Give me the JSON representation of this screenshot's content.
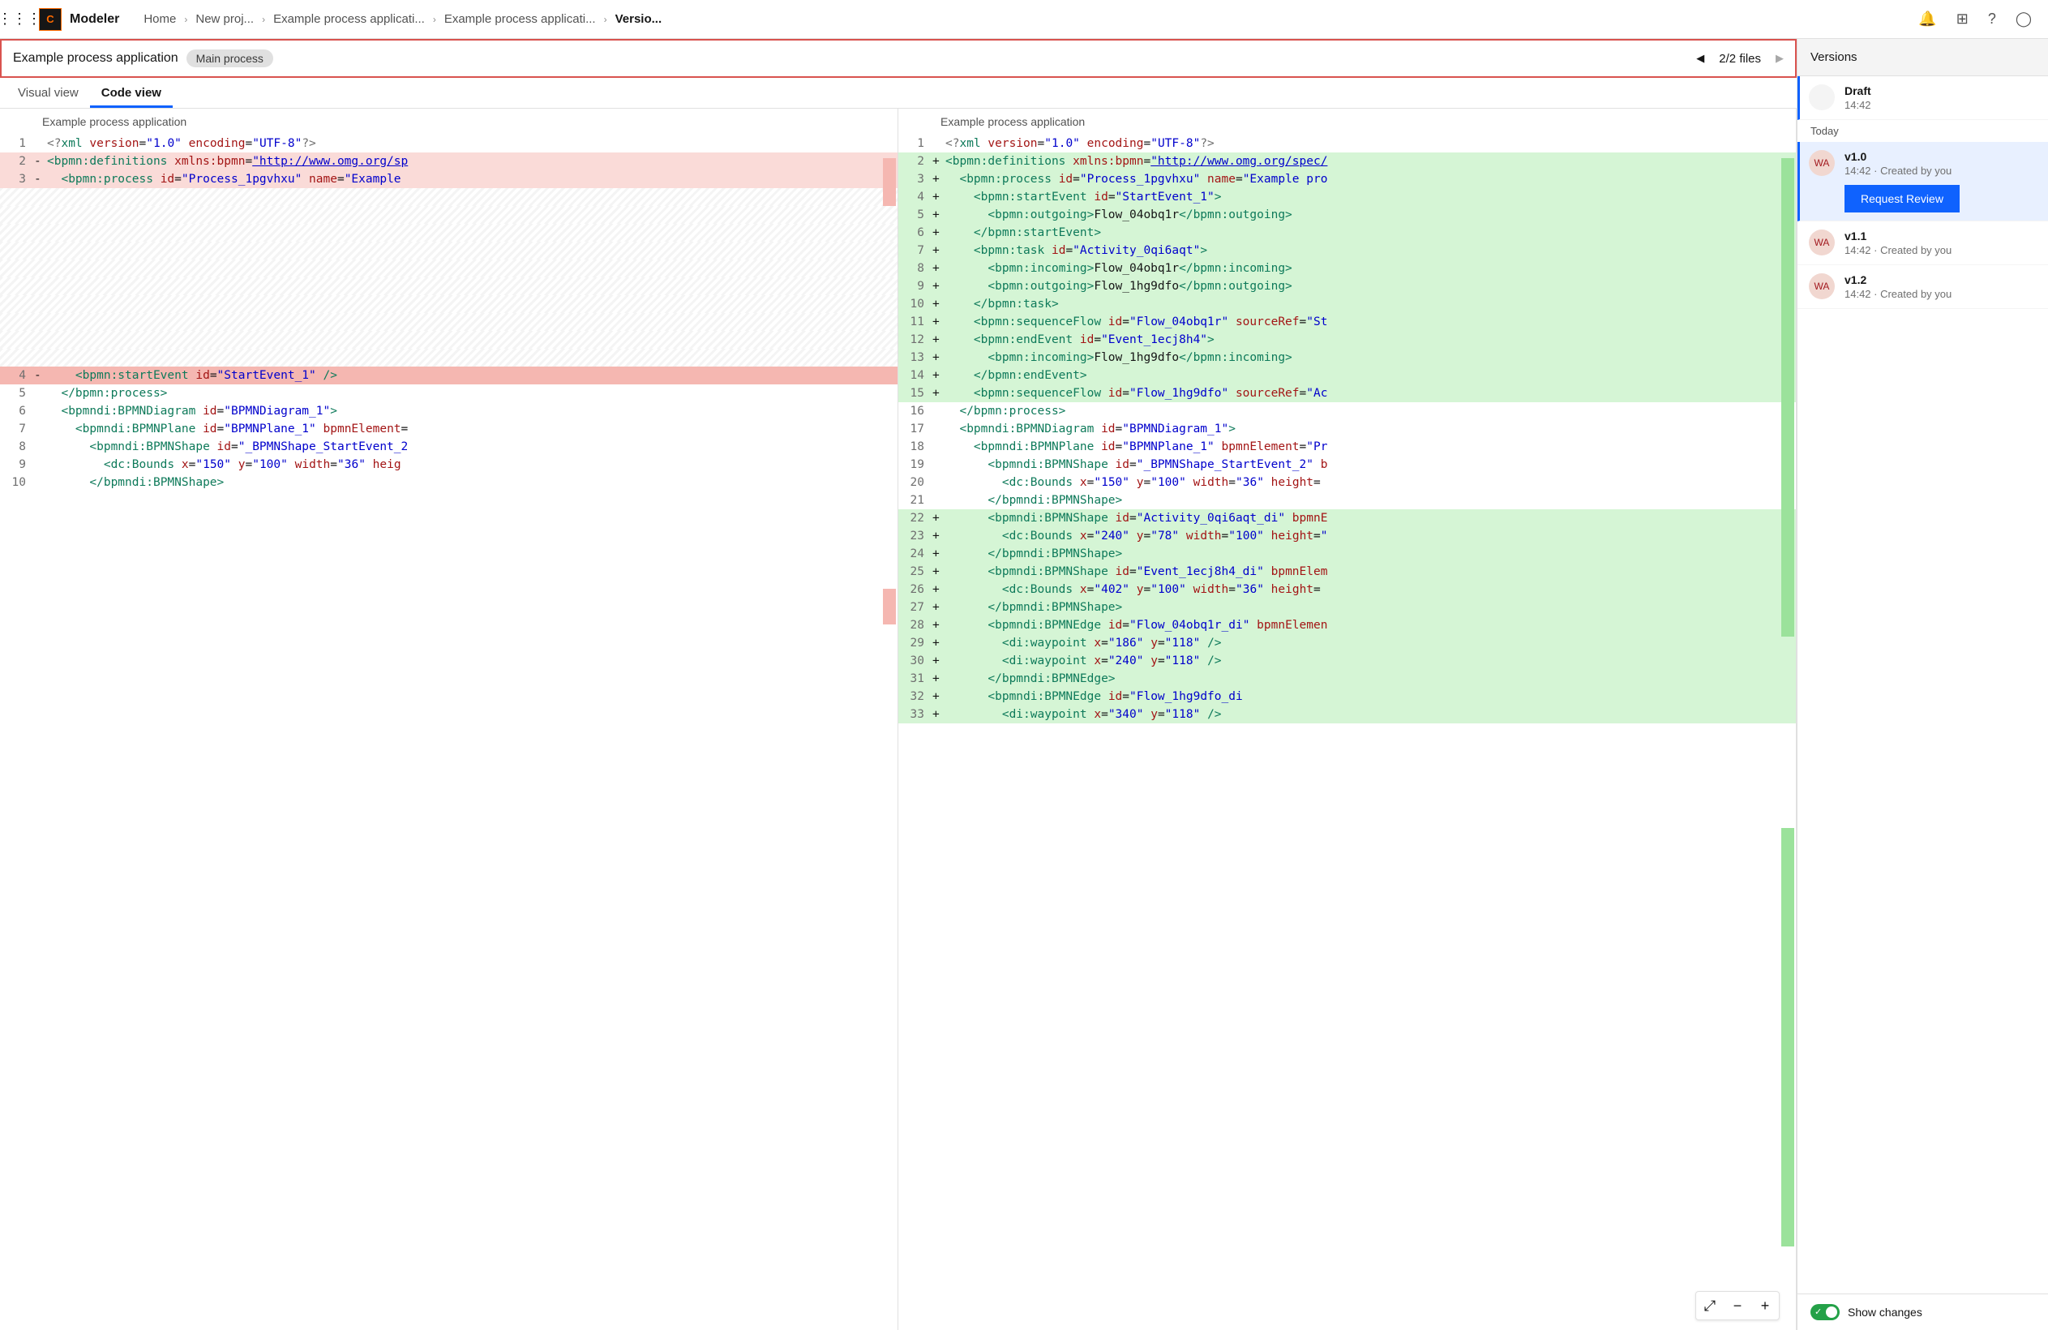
{
  "brand": {
    "initial": "C",
    "name": "Modeler"
  },
  "breadcrumb": {
    "items": [
      "Home",
      "New proj...",
      "Example process applicati...",
      "Example process applicati...",
      "Versio..."
    ]
  },
  "subheader": {
    "title": "Example process application",
    "chip": "Main process",
    "file_counter": "2/2 files"
  },
  "tabs": {
    "visual": "Visual view",
    "code": "Code view"
  },
  "panes": {
    "left_title": "Example process application",
    "right_title": "Example process application"
  },
  "sidebar": {
    "title": "Versions",
    "today": "Today",
    "draft": {
      "name": "Draft",
      "time": "14:42"
    },
    "items": [
      {
        "avatar": "WA",
        "name": "v1.0",
        "sub": "14:42 · Created by you",
        "selected": true,
        "button": "Request Review"
      },
      {
        "avatar": "WA",
        "name": "v1.1",
        "sub": "14:42 · Created by you"
      },
      {
        "avatar": "WA",
        "name": "v1.2",
        "sub": "14:42 · Created by you"
      }
    ],
    "toggle_label": "Show changes"
  },
  "code_left": [
    {
      "n": "1",
      "bg": "",
      "html": "<span class='t-pi'>&lt;?</span><span class='t-tag'>xml</span> <span class='t-dkred'>version</span>=<span class='t-blue'>\"1.0\"</span> <span class='t-dkred'>encoding</span>=<span class='t-blue'>\"UTF-8\"</span><span class='t-pi'>?&gt;</span>"
    },
    {
      "n": "2",
      "bg": "bg-del",
      "gut": "-",
      "html": "<span class='t-green'>&lt;bpmn:definitions</span> <span class='t-dkred'>xmlns:bpmn</span>=<span class='t-blue'><u>\"http://www.omg.org/sp</u></span>"
    },
    {
      "n": "3",
      "bg": "bg-del",
      "gut": "-",
      "html": "  <span class='t-green'>&lt;bpmn:process</span> <span class='t-dkred'>id</span>=<span class='t-blue'>\"Process_1pgvhxu\"</span> <span class='t-dkred'>name</span>=<span class='t-blue'>\"Example </span>"
    },
    {
      "n": "",
      "bg": "bg-hatch",
      "html": "&nbsp;"
    },
    {
      "n": "",
      "bg": "bg-hatch",
      "html": "&nbsp;"
    },
    {
      "n": "",
      "bg": "bg-hatch",
      "html": "&nbsp;"
    },
    {
      "n": "",
      "bg": "bg-hatch",
      "html": "&nbsp;"
    },
    {
      "n": "",
      "bg": "bg-hatch",
      "html": "&nbsp;"
    },
    {
      "n": "",
      "bg": "bg-hatch",
      "html": "&nbsp;"
    },
    {
      "n": "",
      "bg": "bg-hatch",
      "html": "&nbsp;"
    },
    {
      "n": "",
      "bg": "bg-hatch",
      "html": "&nbsp;"
    },
    {
      "n": "",
      "bg": "bg-hatch",
      "html": "&nbsp;"
    },
    {
      "n": "",
      "bg": "bg-hatch",
      "html": "&nbsp;"
    },
    {
      "n": "4",
      "bg": "bg-del-strong",
      "gut": "-",
      "html": "    <span class='t-green' style='background:#f5b7b1'>&lt;bpmn:startEvent</span> <span class='t-dkred'>id</span>=<span class='t-blue'>\"StartEvent_1\"</span> <span class='t-green'>/&gt;</span>"
    },
    {
      "n": "5",
      "bg": "",
      "html": "  <span class='t-green'>&lt;/bpmn:process&gt;</span>"
    },
    {
      "n": "6",
      "bg": "",
      "html": "  <span class='t-green'>&lt;bpmndi:BPMNDiagram</span> <span class='t-dkred'>id</span>=<span class='t-blue'>\"BPMNDiagram_1\"</span><span class='t-green'>&gt;</span>"
    },
    {
      "n": "7",
      "bg": "",
      "html": "    <span class='t-green'>&lt;bpmndi:BPMNPlane</span> <span class='t-dkred'>id</span>=<span class='t-blue'>\"BPMNPlane_1\"</span> <span class='t-dkred'>bpmnElement</span>="
    },
    {
      "n": "8",
      "bg": "",
      "html": "      <span class='t-green'>&lt;bpmndi:BPMNShape</span> <span class='t-dkred'>id</span>=<span class='t-blue'>\"_BPMNShape_StartEvent_2</span>"
    },
    {
      "n": "9",
      "bg": "",
      "html": "        <span class='t-green'>&lt;dc:Bounds</span> <span class='t-dkred'>x</span>=<span class='t-blue'>\"150\"</span> <span class='t-dkred'>y</span>=<span class='t-blue'>\"100\"</span> <span class='t-dkred'>width</span>=<span class='t-blue'>\"36\"</span> <span class='t-dkred'>heig</span>"
    },
    {
      "n": "10",
      "bg": "",
      "html": "      <span class='t-green'>&lt;/bpmndi:BPMNShape&gt;</span>"
    }
  ],
  "code_right": [
    {
      "n": "1",
      "bg": "",
      "html": "<span class='t-pi'>&lt;?</span><span class='t-tag'>xml</span> <span class='t-dkred'>version</span>=<span class='t-blue'>\"1.0\"</span> <span class='t-dkred'>encoding</span>=<span class='t-blue'>\"UTF-8\"</span><span class='t-pi'>?&gt;</span>"
    },
    {
      "n": "2",
      "bg": "bg-add",
      "gut": "+",
      "html": "<span class='t-green'>&lt;bpmn:definitions</span> <span class='t-dkred'>xmlns:bpmn</span>=<span class='t-blue'><u>\"http://www.omg.org/spec/</u></span>"
    },
    {
      "n": "3",
      "bg": "bg-add",
      "gut": "+",
      "html": "  <span class='t-green'>&lt;bpmn:process</span> <span class='t-dkred'>id</span>=<span class='t-blue'>\"Process_1pgvhxu\"</span> <span class='t-dkred'>name</span>=<span class='t-blue'>\"Example pro</span>"
    },
    {
      "n": "4",
      "bg": "bg-add",
      "gut": "+",
      "html": "    <span class='t-green'>&lt;bpmn:startEvent</span> <span class='t-dkred'>id</span>=<span class='t-blue'>\"StartEvent_1\"</span><span class='t-green'>&gt;</span>"
    },
    {
      "n": "5",
      "bg": "bg-add",
      "gut": "+",
      "html": "      <span class='t-green'>&lt;bpmn:outgoing&gt;</span>Flow_04obq1r<span class='t-green'>&lt;/bpmn:outgoing&gt;</span>"
    },
    {
      "n": "6",
      "bg": "bg-add",
      "gut": "+",
      "html": "    <span class='t-green'>&lt;/bpmn:startEvent&gt;</span>"
    },
    {
      "n": "7",
      "bg": "bg-add",
      "gut": "+",
      "html": "    <span class='t-green'>&lt;bpmn:task</span> <span class='t-dkred'>id</span>=<span class='t-blue'>\"Activity_0qi6aqt\"</span><span class='t-green'>&gt;</span>"
    },
    {
      "n": "8",
      "bg": "bg-add",
      "gut": "+",
      "html": "      <span class='t-green'>&lt;bpmn:incoming&gt;</span>Flow_04obq1r<span class='t-green'>&lt;/bpmn:incoming&gt;</span>"
    },
    {
      "n": "9",
      "bg": "bg-add",
      "gut": "+",
      "html": "      <span class='t-green'>&lt;bpmn:outgoing&gt;</span>Flow_1hg9dfo<span class='t-green'>&lt;/bpmn:outgoing&gt;</span>"
    },
    {
      "n": "10",
      "bg": "bg-add",
      "gut": "+",
      "html": "    <span class='t-green'>&lt;/bpmn:task&gt;</span>"
    },
    {
      "n": "11",
      "bg": "bg-add",
      "gut": "+",
      "html": "    <span class='t-green'>&lt;bpmn:sequenceFlow</span> <span class='t-dkred'>id</span>=<span class='t-blue'>\"Flow_04obq1r\"</span> <span class='t-dkred'>sourceRef</span>=<span class='t-blue'>\"St</span>"
    },
    {
      "n": "12",
      "bg": "bg-add",
      "gut": "+",
      "html": "    <span class='t-green'>&lt;bpmn:endEvent</span> <span class='t-dkred'>id</span>=<span class='t-blue'>\"Event_1ecj8h4\"</span><span class='t-green'>&gt;</span>"
    },
    {
      "n": "13",
      "bg": "bg-add",
      "gut": "+",
      "html": "      <span class='t-green'>&lt;bpmn:incoming&gt;</span>Flow_1hg9dfo<span class='t-green'>&lt;/bpmn:incoming&gt;</span>"
    },
    {
      "n": "14",
      "bg": "bg-add",
      "gut": "+",
      "html": "    <span class='t-green'>&lt;/bpmn:endEvent&gt;</span>"
    },
    {
      "n": "15",
      "bg": "bg-add",
      "gut": "+",
      "html": "    <span class='t-green'>&lt;bpmn:sequenceFlow</span> <span class='t-dkred'>id</span>=<span class='t-blue'>\"Flow_1hg9dfo\"</span> <span class='t-dkred'>sourceRef</span>=<span class='t-blue'>\"Ac</span>"
    },
    {
      "n": "16",
      "bg": "",
      "html": "  <span class='t-green'>&lt;/bpmn:process&gt;</span>"
    },
    {
      "n": "17",
      "bg": "",
      "html": "  <span class='t-green'>&lt;bpmndi:BPMNDiagram</span> <span class='t-dkred'>id</span>=<span class='t-blue'>\"BPMNDiagram_1\"</span><span class='t-green'>&gt;</span>"
    },
    {
      "n": "18",
      "bg": "",
      "html": "    <span class='t-green'>&lt;bpmndi:BPMNPlane</span> <span class='t-dkred'>id</span>=<span class='t-blue'>\"BPMNPlane_1\"</span> <span class='t-dkred'>bpmnElement</span>=<span class='t-blue'>\"Pr</span>"
    },
    {
      "n": "19",
      "bg": "",
      "html": "      <span class='t-green'>&lt;bpmndi:BPMNShape</span> <span class='t-dkred'>id</span>=<span class='t-blue'>\"_BPMNShape_StartEvent_2\"</span> <span class='t-dkred'>b</span>"
    },
    {
      "n": "20",
      "bg": "",
      "html": "        <span class='t-green'>&lt;dc:Bounds</span> <span class='t-dkred'>x</span>=<span class='t-blue'>\"150\"</span> <span class='t-dkred'>y</span>=<span class='t-blue'>\"100\"</span> <span class='t-dkred'>width</span>=<span class='t-blue'>\"36\"</span> <span class='t-dkred'>height</span>="
    },
    {
      "n": "21",
      "bg": "",
      "html": "      <span class='t-green'>&lt;/bpmndi:BPMNShape&gt;</span>"
    },
    {
      "n": "22",
      "bg": "bg-add",
      "gut": "+",
      "html": "      <span class='t-green'>&lt;bpmndi:BPMNShape</span> <span class='t-dkred'>id</span>=<span class='t-blue'>\"Activity_0qi6aqt_di\"</span> <span class='t-dkred'>bpmnE</span>"
    },
    {
      "n": "23",
      "bg": "bg-add",
      "gut": "+",
      "html": "        <span class='t-green'>&lt;dc:Bounds</span> <span class='t-dkred'>x</span>=<span class='t-blue'>\"240\"</span> <span class='t-dkred'>y</span>=<span class='t-blue'>\"78\"</span> <span class='t-dkred'>width</span>=<span class='t-blue'>\"100\"</span> <span class='t-dkred'>height</span>=<span class='t-blue'>\"</span>"
    },
    {
      "n": "24",
      "bg": "bg-add",
      "gut": "+",
      "html": "      <span class='t-green'>&lt;/bpmndi:BPMNShape&gt;</span>"
    },
    {
      "n": "25",
      "bg": "bg-add",
      "gut": "+",
      "html": "      <span class='t-green'>&lt;bpmndi:BPMNShape</span> <span class='t-dkred'>id</span>=<span class='t-blue'>\"Event_1ecj8h4_di\"</span> <span class='t-dkred'>bpmnElem</span>"
    },
    {
      "n": "26",
      "bg": "bg-add",
      "gut": "+",
      "html": "        <span class='t-green'>&lt;dc:Bounds</span> <span class='t-dkred'>x</span>=<span class='t-blue'>\"402\"</span> <span class='t-dkred'>y</span>=<span class='t-blue'>\"100\"</span> <span class='t-dkred'>width</span>=<span class='t-blue'>\"36\"</span> <span class='t-dkred'>height</span>="
    },
    {
      "n": "27",
      "bg": "bg-add",
      "gut": "+",
      "html": "      <span class='t-green'>&lt;/bpmndi:BPMNShape&gt;</span>"
    },
    {
      "n": "28",
      "bg": "bg-add",
      "gut": "+",
      "html": "      <span class='t-green'>&lt;bpmndi:BPMNEdge</span> <span class='t-dkred'>id</span>=<span class='t-blue'>\"Flow_04obq1r_di\"</span> <span class='t-dkred'>bpmnElemen</span>"
    },
    {
      "n": "29",
      "bg": "bg-add",
      "gut": "+",
      "html": "        <span class='t-green'>&lt;di:waypoint</span> <span class='t-dkred'>x</span>=<span class='t-blue'>\"186\"</span> <span class='t-dkred'>y</span>=<span class='t-blue'>\"118\"</span> <span class='t-green'>/&gt;</span>"
    },
    {
      "n": "30",
      "bg": "bg-add",
      "gut": "+",
      "html": "        <span class='t-green'>&lt;di:waypoint</span> <span class='t-dkred'>x</span>=<span class='t-blue'>\"240\"</span> <span class='t-dkred'>y</span>=<span class='t-blue'>\"118\"</span> <span class='t-green'>/&gt;</span>"
    },
    {
      "n": "31",
      "bg": "bg-add",
      "gut": "+",
      "html": "      <span class='t-green'>&lt;/bpmndi:BPMNEdge&gt;</span>"
    },
    {
      "n": "32",
      "bg": "bg-add",
      "gut": "+",
      "html": "      <span class='t-green'>&lt;bpmndi:BPMNEdge</span> <span class='t-dkred'>id</span>=<span class='t-blue'>\"Flow_1hg9dfo_di</span>"
    },
    {
      "n": "33",
      "bg": "bg-add",
      "gut": "+",
      "html": "        <span class='t-green'>&lt;di:waypoint</span> <span class='t-dkred'>x</span>=<span class='t-blue'>\"340\"</span> <span class='t-dkred'>y</span>=<span class='t-blue'>\"118\"</span> <span class='t-green'>/&gt;</span>"
    }
  ]
}
